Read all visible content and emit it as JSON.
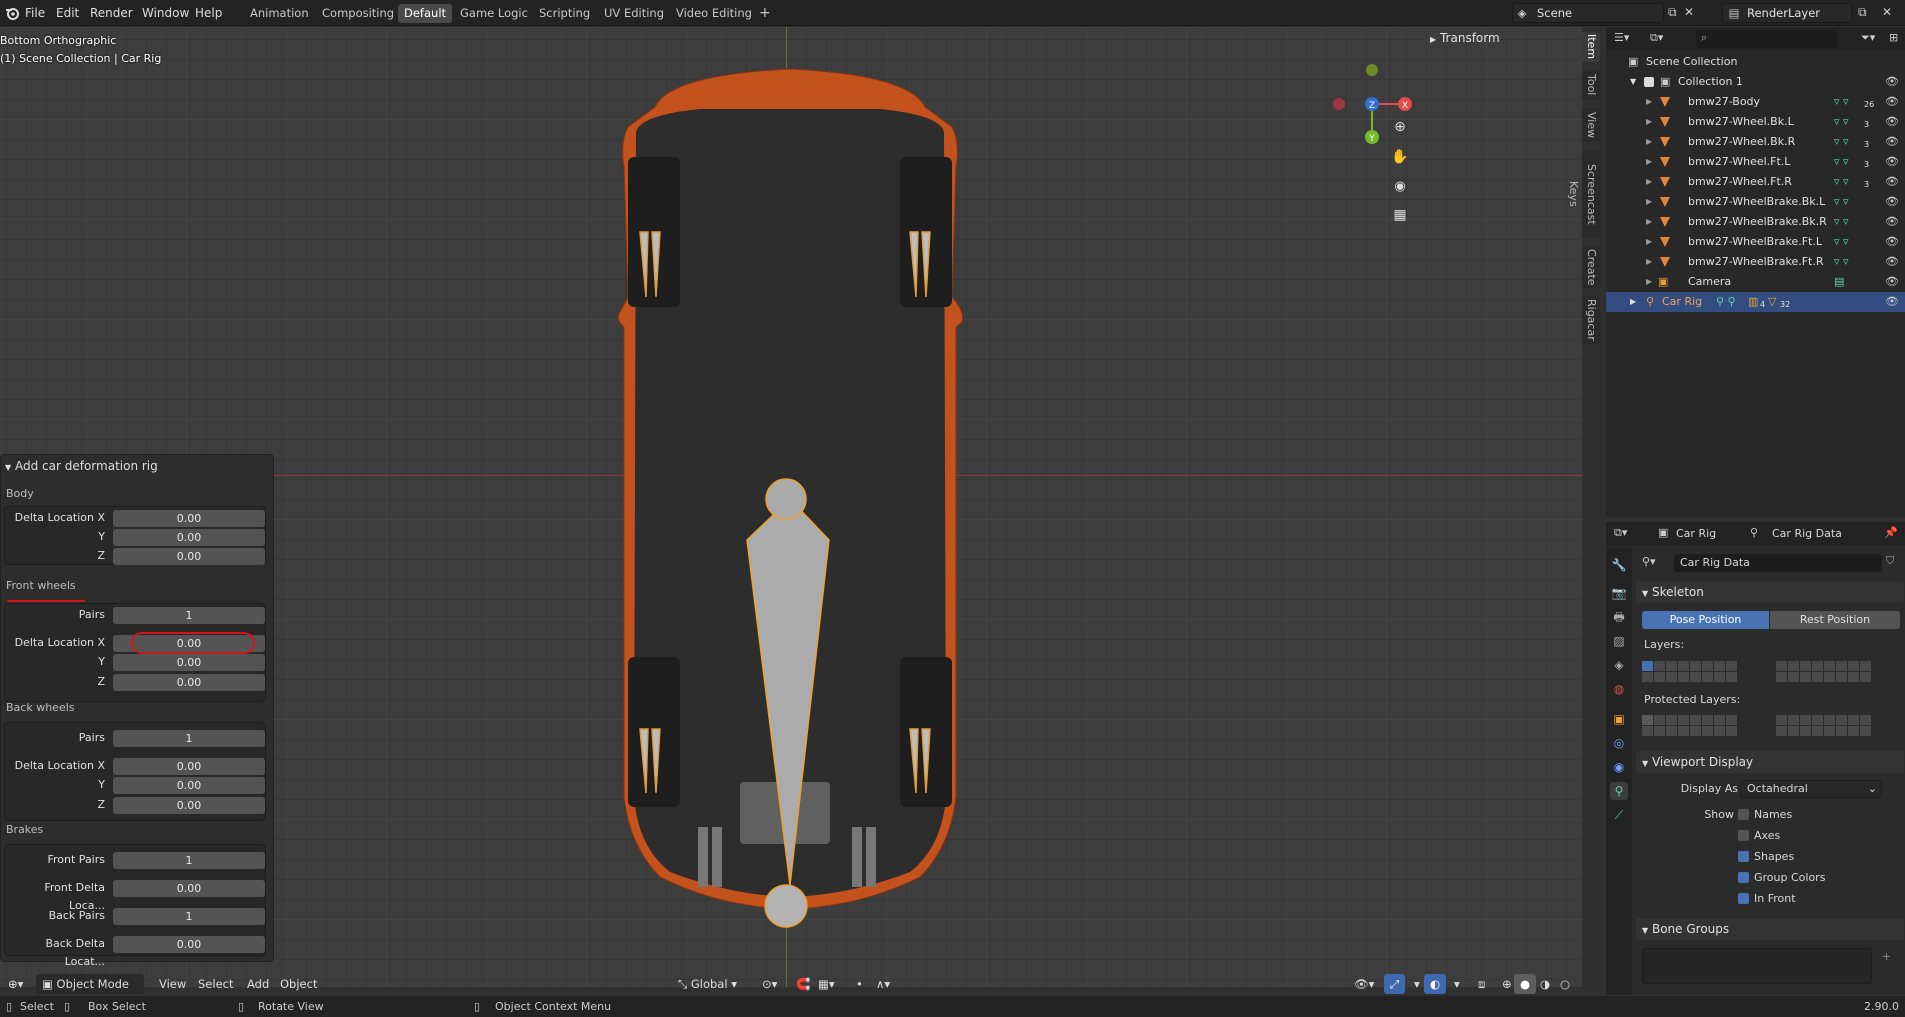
{
  "topbar": {
    "menus": [
      "File",
      "Edit",
      "Render",
      "Window",
      "Help"
    ],
    "workspaces": [
      "Animation",
      "Compositing",
      "Default",
      "Game Logic",
      "Scripting",
      "UV Editing",
      "Video Editing"
    ],
    "active_workspace": "Default",
    "add_tab": "+",
    "scene": "Scene",
    "view_layer": "RenderLayer"
  },
  "viewport": {
    "view_name": "Bottom Orthographic",
    "collection_info": "(1) Scene Collection | Car Rig",
    "n_panel_header": "Transform",
    "side_tabs": [
      "Item",
      "Tool",
      "View",
      "Screencast Keys",
      "Create",
      "Rigacar"
    ],
    "gizmo_axes": {
      "z": "Z",
      "x": "X",
      "y": "Y"
    },
    "gizmo_colors": {
      "z": "#2f6fd6",
      "x": "#e54b4b",
      "y": "#76b82a"
    },
    "car_body_color": "#c4521c",
    "bone_color": "#a9a9a9",
    "selection_outline": "#f0a030"
  },
  "operator_panel": {
    "title": "Add car deformation rig",
    "body": {
      "label": "Body",
      "delta_x_label": "Delta Location X",
      "y_label": "Y",
      "z_label": "Z",
      "x": "0.00",
      "y": "0.00",
      "z": "0.00"
    },
    "front_wheels": {
      "label": "Front wheels",
      "pairs_label": "Pairs",
      "pairs": "1",
      "delta_x_label": "Delta Location X",
      "y_label": "Y",
      "z_label": "Z",
      "x": "0.00",
      "y": "0.00",
      "z": "0.00"
    },
    "back_wheels": {
      "label": "Back wheels",
      "pairs_label": "Pairs",
      "pairs": "1",
      "delta_x_label": "Delta Location X",
      "y_label": "Y",
      "z_label": "Z",
      "x": "0.00",
      "y": "0.00",
      "z": "0.00"
    },
    "brakes": {
      "label": "Brakes",
      "front_pairs_label": "Front Pairs",
      "front_pairs": "1",
      "front_delta_label": "Front Delta Loca...",
      "front_delta": "0.00",
      "back_pairs_label": "Back Pairs",
      "back_pairs": "1",
      "back_delta_label": "Back Delta Locat...",
      "back_delta": "0.00"
    }
  },
  "viewport_header": {
    "mode": "Object Mode",
    "menus": [
      "View",
      "Select",
      "Add",
      "Object"
    ],
    "transform_orientation": "Global"
  },
  "statusbar": {
    "select": "Select",
    "box_select": "Box Select",
    "rotate_view": "Rotate View",
    "context_menu": "Object Context Menu",
    "version": "2.90.0"
  },
  "outliner": {
    "root": "Scene Collection",
    "collection": "Collection 1",
    "items": [
      {
        "name": "bmw27-Body",
        "badge": "26"
      },
      {
        "name": "bmw27-Wheel.Bk.L",
        "badge": "3"
      },
      {
        "name": "bmw27-Wheel.Bk.R",
        "badge": "3"
      },
      {
        "name": "bmw27-Wheel.Ft.L",
        "badge": "3"
      },
      {
        "name": "bmw27-Wheel.Ft.R",
        "badge": "3"
      },
      {
        "name": "bmw27-WheelBrake.Bk.L",
        "badge": ""
      },
      {
        "name": "bmw27-WheelBrake.Bk.R",
        "badge": ""
      },
      {
        "name": "bmw27-WheelBrake.Ft.L",
        "badge": ""
      },
      {
        "name": "bmw27-WheelBrake.Ft.R",
        "badge": ""
      },
      {
        "name": "Camera",
        "badge": ""
      }
    ],
    "selected": {
      "name": "Car Rig",
      "badge1": "4",
      "badge2": "32"
    }
  },
  "properties": {
    "object_name": "Car Rig",
    "data_name": "Car Rig Data",
    "datablock": "Car Rig Data",
    "skeleton": {
      "title": "Skeleton",
      "pose_position": "Pose Position",
      "rest_position": "Rest Position",
      "layers_label": "Layers:",
      "protected_label": "Protected Layers:"
    },
    "viewport_display": {
      "title": "Viewport Display",
      "display_as_label": "Display As",
      "display_as": "Octahedral",
      "show_label": "Show",
      "names": "Names",
      "axes": "Axes",
      "shapes": "Shapes",
      "group_colors": "Group Colors",
      "in_front": "In Front",
      "names_checked": false,
      "axes_checked": false,
      "shapes_checked": true,
      "group_colors_checked": true,
      "in_front_checked": true
    },
    "bone_groups": {
      "title": "Bone Groups"
    }
  }
}
